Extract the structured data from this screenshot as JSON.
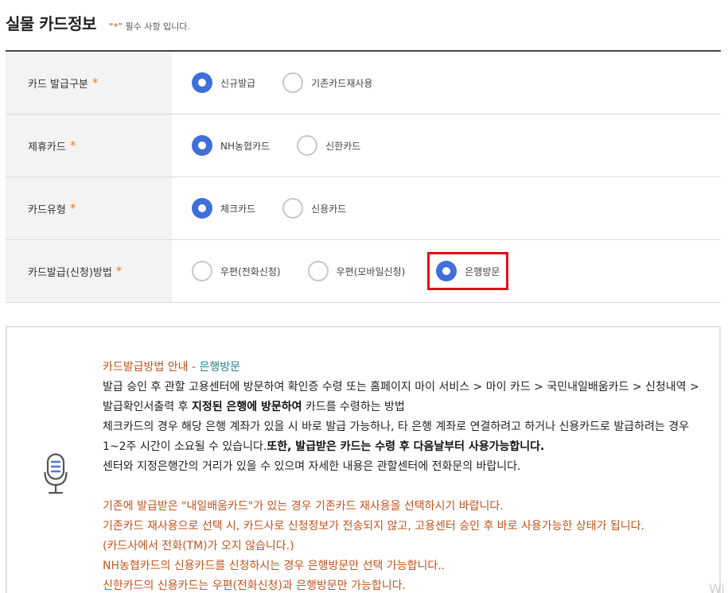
{
  "header": {
    "title": "실물 카드정보",
    "req_quote_open": "“",
    "req_star": "*",
    "req_quote_close": "”",
    "req_text": " 필수 사항 입니다."
  },
  "form": {
    "rows": [
      {
        "label": "카드 발급구분",
        "options": [
          {
            "label": "신규발급",
            "selected": true
          },
          {
            "label": "기존카드재사용",
            "selected": false
          }
        ]
      },
      {
        "label": "제휴카드",
        "options": [
          {
            "label": "NH농협카드",
            "selected": true
          },
          {
            "label": "신한카드",
            "selected": false
          }
        ]
      },
      {
        "label": "카드유형",
        "options": [
          {
            "label": "체크카드",
            "selected": true
          },
          {
            "label": "신용카드",
            "selected": false
          }
        ]
      },
      {
        "label": "카드발급(신청)방법",
        "options": [
          {
            "label": "우편(전화신청)",
            "selected": false
          },
          {
            "label": "우편(모바일신청)",
            "selected": false
          },
          {
            "label": "은행방문",
            "selected": true
          }
        ]
      }
    ],
    "required_mark": "*"
  },
  "info": {
    "title_main": "카드발급방법 안내 - ",
    "title_sub": "은행방문",
    "line1": "발급 승인 후 관할 고용센터에 방문하여 확인증 수령 또는 홈페이지 마이 서비스 > 마이 카드 > 국민내일배움카드 > 신청내역 > 발급확인서출력 후 ",
    "line1_bold": "지정된 은행에 방문하여",
    "line1_end": " 카드를 수령하는 방법",
    "line2": "체크카드의 경우 해당 은행 계좌가 있을 시 바로 발급 가능하나, 타 은행 계좌로 연결하려고 하거나 신용카드로 발급하려는 경우 1~2주 시간이 소요될 수 있습니다.",
    "line2_bold": "또한, 발급받은 카드는 수령 후 다음날부터 사용가능합니다.",
    "line3": "센터와 지정은행간의 거리가 있을 수 있으며 자세한 내용은 관할센터에 전화문의 바랍니다.",
    "notes": [
      "기존에 발급받은 \"내일배움카드\"가 있는 경우 기존카드 재사용을 선택하시기 바랍니다.",
      "기존카드 재사용으로 선택 시, 카드사로 신청정보가 전송되지 않고, 고용센터 승인 후 바로 사용가능한 상태가 됩니다.",
      "(카드사에서 전화(TM)가 오지 않습니다.)",
      "NH농협카드의 신용카드를 신청하시는 경우 은행방문만 선택 가능합니다..",
      "신한카드의 신용카드는 우편(전화신청)과 은행방문만 가능합니다."
    ]
  },
  "watermark": "Wi",
  "colors": {
    "accent": "#3f6fdb",
    "required": "#f07a24",
    "highlight_border": "#e50d16",
    "note_text": "#c2541f"
  }
}
